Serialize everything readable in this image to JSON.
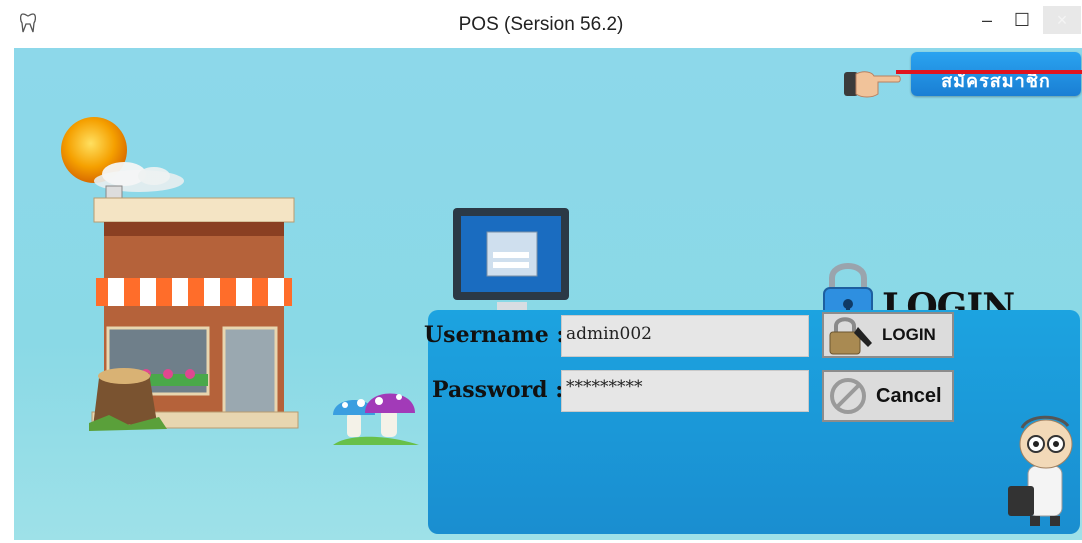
{
  "window": {
    "title": "POS (Sersion 56.2)",
    "minimize_glyph": "–",
    "maximize_glyph": "☐",
    "close_glyph": "×"
  },
  "header": {
    "register_button_label": "สมัครสมาชิก"
  },
  "login_panel": {
    "heading": "LOGIN",
    "username_label": "Username :",
    "username_value": "admin002",
    "password_label": "Password :",
    "password_value": "*********",
    "login_button_label": "LOGIN",
    "cancel_button_label": "Cancel"
  },
  "icons": {
    "app": "tooth-icon",
    "pointer": "pointing-hand-icon",
    "lock": "padlock-icon",
    "login_button": "padlock-key-icon",
    "cancel_button": "cancel-circle-icon"
  },
  "colors": {
    "background": "#8dd8ea",
    "panel": "#1a9ad8",
    "register_button": "#1f8fe0",
    "red_line": "#e0141e"
  }
}
